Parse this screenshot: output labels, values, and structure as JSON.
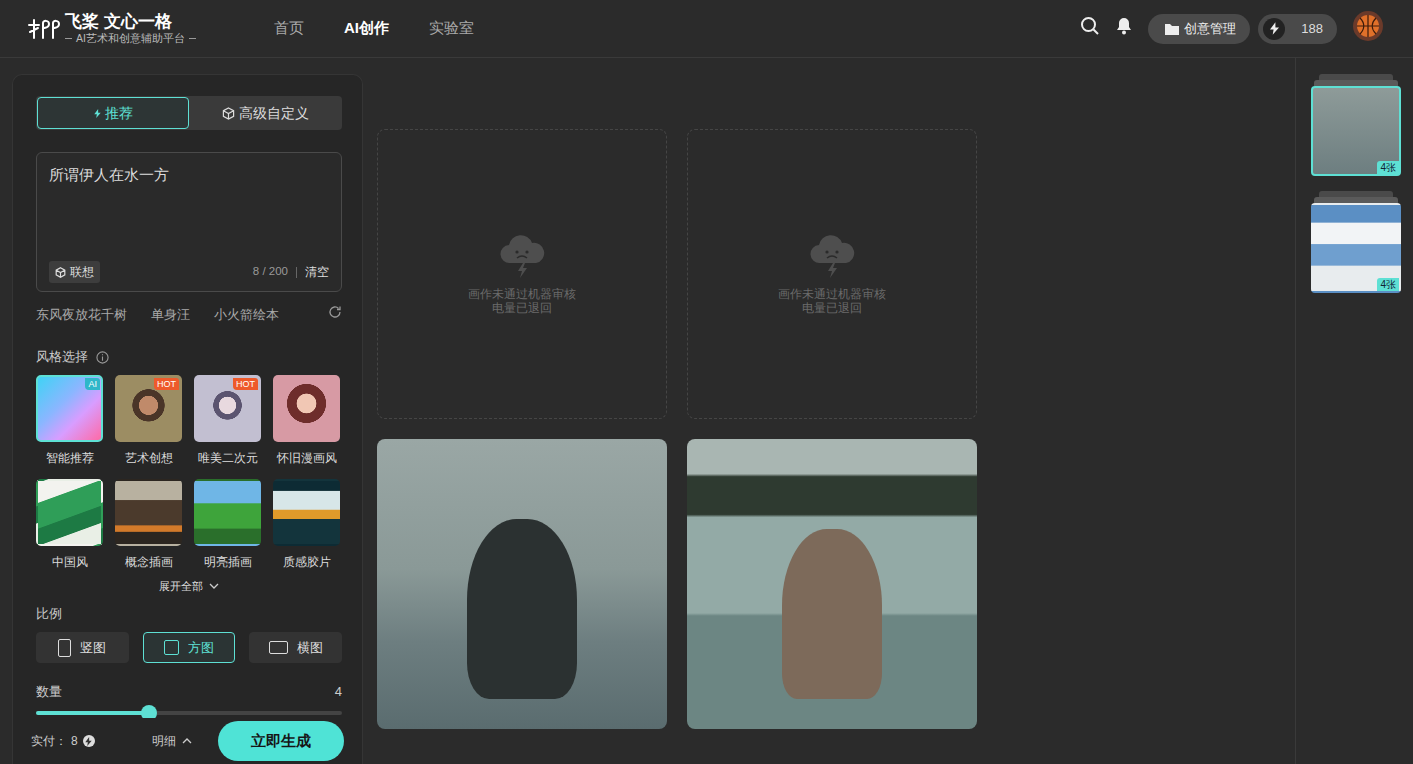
{
  "header": {
    "logo": {
      "brand": "飞桨",
      "product": "文心一格",
      "tagline": "AI艺术和创意辅助平台"
    },
    "nav": [
      {
        "label": "首页",
        "selected": false
      },
      {
        "label": "AI创作",
        "selected": true
      },
      {
        "label": "实验室",
        "selected": false
      }
    ],
    "manage_button": "创意管理",
    "energy": "188"
  },
  "mode_tabs": [
    {
      "label": "推荐",
      "selected": true
    },
    {
      "label": "高级自定义",
      "selected": false
    }
  ],
  "prompt": {
    "value": "所谓伊人在水一方",
    "associate": "联想",
    "count": "8 / 200",
    "clear": "清空"
  },
  "suggestions": [
    "东风夜放花千树",
    "单身汪",
    "小火箭绘本"
  ],
  "styles": {
    "title": "风格选择",
    "items": [
      {
        "label": "智能推荐",
        "badge": "AI",
        "selected": true
      },
      {
        "label": "艺术创想",
        "badge": "HOT",
        "selected": false
      },
      {
        "label": "唯美二次元",
        "badge": "HOT",
        "selected": false
      },
      {
        "label": "怀旧漫画风",
        "selected": false
      },
      {
        "label": "中国风",
        "selected": false
      },
      {
        "label": "概念插画",
        "selected": false
      },
      {
        "label": "明亮插画",
        "selected": false
      },
      {
        "label": "质感胶片",
        "selected": false
      }
    ],
    "expand": "展开全部"
  },
  "ratio": {
    "title": "比例",
    "options": [
      {
        "label": "竖图",
        "selected": false
      },
      {
        "label": "方图",
        "selected": true
      },
      {
        "label": "横图",
        "selected": false
      }
    ]
  },
  "quantity": {
    "title": "数量",
    "value": "4",
    "level": 0.37
  },
  "footer": {
    "price_label": "实付：",
    "price": "8",
    "detail": "明细",
    "generate": "立即生成"
  },
  "results": [
    {
      "kind": "failed",
      "message": "画作未通过机器审核",
      "note": "电量已退回"
    },
    {
      "kind": "failed",
      "message": "画作未通过机器审核",
      "note": "电量已退回"
    },
    {
      "kind": "image"
    },
    {
      "kind": "image"
    }
  ],
  "history": [
    {
      "count": "4张",
      "selected": true
    },
    {
      "count": "4张",
      "selected": false
    }
  ]
}
